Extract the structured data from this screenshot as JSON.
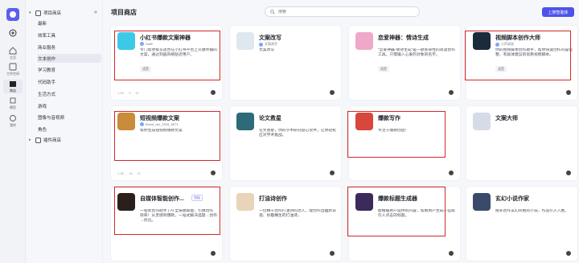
{
  "rail": {
    "items": [
      {
        "label": ""
      },
      {
        "label": "主页"
      },
      {
        "label": "工作空间"
      },
      {
        "label": "商店"
      },
      {
        "label": "模型"
      },
      {
        "label": "我的"
      }
    ]
  },
  "categories": {
    "project_store": "项目商店",
    "items": [
      "最新",
      "效率工具",
      "商业服务",
      "文本创作",
      "学习教育",
      "代码助手",
      "生活方式",
      "游戏",
      "图像与音视频",
      "角色"
    ],
    "plugin_store": "插件商店"
  },
  "header": {
    "title": "项目商店",
    "search_placeholder": "搜索",
    "publish_label": "上架智能体"
  },
  "colors": {
    "accent": "#4d53e8",
    "highlight": "#d02a2a"
  },
  "cards": [
    {
      "name": "小红书爆款文案神器",
      "author": "Swift",
      "desc": "专门帮你撰写适合在小红书平台上火爆传播的文案，通过刻画风格贴近用户。",
      "tag": "语音",
      "stats": [
        "1.1K",
        "9",
        "11"
      ]
    },
    {
      "name": "文案改写",
      "author": "文案改写",
      "desc": "文案改写",
      "tag": "",
      "stats": [
        "",
        "",
        ""
      ]
    },
    {
      "name": "恋爱神器：情诗生成",
      "author": "",
      "desc": "“恋爱神器-情诗生成”是一款革命性的浪漫创作工具，只需输入心爱的对象的名字。",
      "tag": "语音",
      "stats": [
        "",
        "",
        ""
      ]
    },
    {
      "name": "视频脚本创作大师",
      "author": "小声说说",
      "desc": "你的视频脚本创作助手，帮你快速创作内容完整、有具体建议的优质视频脚本。",
      "tag": "语音",
      "stats": [
        "",
        "",
        ""
      ]
    },
    {
      "name": "短视频爆款文案",
      "author": "Boost_her_2005_6573",
      "desc": "帮你生成短视频爆款文案",
      "tag": "",
      "stats": [
        "1.3K",
        "16",
        "11"
      ]
    },
    {
      "name": "论文救星",
      "author": "",
      "desc": "论文救星，你的学术研究贴心伙伴，让你轻松应对学术挑战。",
      "tag": "",
      "stats": [
        "",
        "",
        ""
      ]
    },
    {
      "name": "爆款写作",
      "author": "",
      "desc": "专注于爆款创造！",
      "tag": "",
      "stats": [
        "",
        "",
        ""
      ]
    },
    {
      "name": "文案大师",
      "author": "",
      "desc": "",
      "tag": "",
      "stats": [
        "",
        "",
        ""
      ]
    },
    {
      "name": "自媒体智能创作...",
      "author": "",
      "desc": "一站式创作助手 | AI 全链路赋能，引爆创作效率！从灵感到爆款，一站式解决选题→创作→优化。",
      "tag": "",
      "badge": "包括",
      "stats": [
        "",
        "",
        ""
      ]
    },
    {
      "name": "打油诗创作",
      "author": "",
      "desc": "一位精于创作打油诗的达人，能创作出幽默诙谐、妙趣横生的打油诗。",
      "tag": "",
      "stats": [
        "",
        "",
        ""
      ]
    },
    {
      "name": "爆款标题生成器",
      "author": "",
      "desc": "能根据用户提供的内容，帮助用户生成一些吸引人点击的标题。",
      "tag": "",
      "stats": [
        "",
        "",
        ""
      ]
    },
    {
      "name": "玄幻小说作家",
      "author": "",
      "desc": "擅长创作玄幻风格的小说，作品引人入胜。",
      "tag": "",
      "stats": [
        "",
        "",
        ""
      ]
    }
  ]
}
